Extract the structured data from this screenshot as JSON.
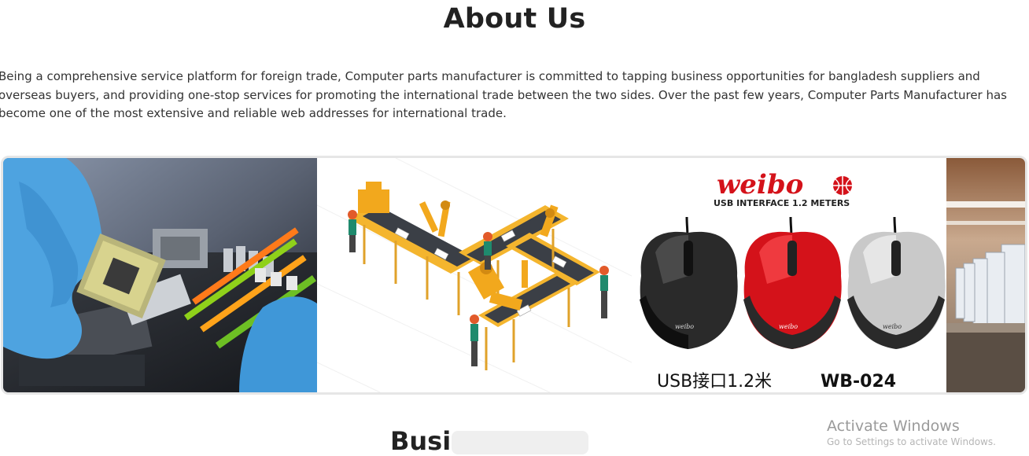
{
  "section": {
    "title": "About Us",
    "intro": "Being a comprehensive service platform for foreign trade, Computer parts manufacturer is committed to tapping business opportunities for bangladesh suppliers and overseas buyers, and providing one-stop services for promoting the international trade between the two sides. Over the past few years, Computer Parts Manufacturer has become one of the most extensive and reliable web addresses for international trade."
  },
  "gallery": {
    "product": {
      "brand": "weibo",
      "tagline": "USB INTERFACE 1.2 METERS",
      "caption_left": "USB接口1.2米",
      "caption_right": "WB-024",
      "mouse_label": "weibo",
      "colors": [
        "#2a2a2a",
        "#d4121a",
        "#c9c9c9"
      ]
    }
  },
  "next_section": {
    "title": "Busi"
  },
  "system": {
    "watermark": "Activate Windows",
    "watermark_sub": "Go to Settings to activate Windows."
  }
}
